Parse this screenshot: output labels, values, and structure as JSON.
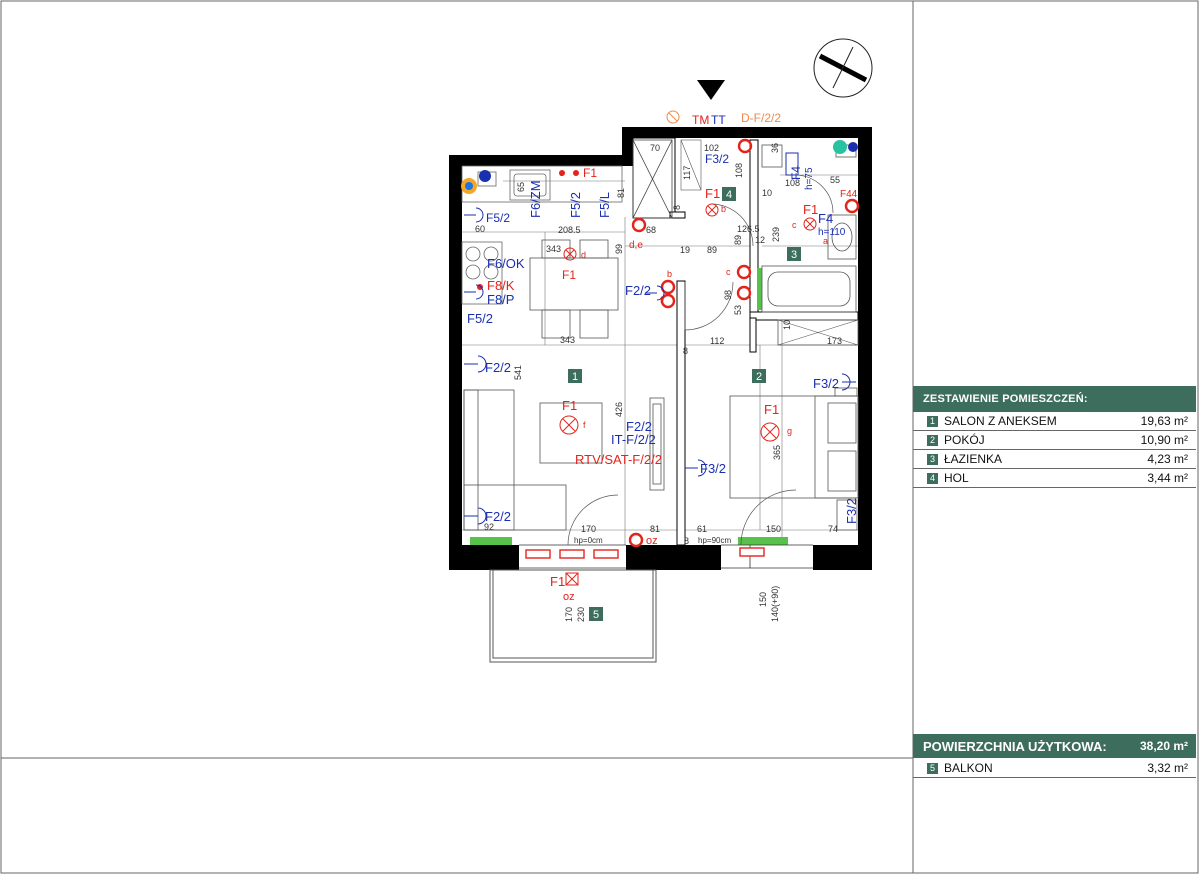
{
  "legend": {
    "title": "ZESTAWIENIE POMIESZCZEŃ:",
    "rooms": [
      {
        "num": "1",
        "name": "SALON Z ANEKSEM",
        "area": "19,63 m²"
      },
      {
        "num": "2",
        "name": "POKÓJ",
        "area": "10,90 m²"
      },
      {
        "num": "3",
        "name": "ŁAZIENKA",
        "area": "4,23 m²"
      },
      {
        "num": "4",
        "name": "HOL",
        "area": "3,44 m²"
      }
    ],
    "total_label": "POWIERZCHNIA UŻYTKOWA:",
    "total_value": "38,20 m²",
    "extra": {
      "num": "5",
      "name": "BALKON",
      "area": "3,32 m²"
    }
  },
  "plan": {
    "room_badges": [
      "1",
      "2",
      "3",
      "4",
      "5"
    ],
    "labels": {
      "tm": "TM",
      "tt": "TT",
      "dfd": "D-F/2/2",
      "f32_top": "F3/2",
      "f1_hol": "F1",
      "f4_top": "F4",
      "h75": "h=75",
      "f1_bath": "F1",
      "f4_bath": "F4",
      "h110": "h=110",
      "f44": "F44",
      "f1_kitchen": "F1",
      "f6zm": "F6/ZM",
      "f52_k": "F5/2",
      "f5l": "F5/L",
      "f52_left": "F5/2",
      "f6ok": "F6/OK",
      "f8k": "F8/K",
      "f8p": "F8/P",
      "f52_left2": "F5/2",
      "f1_table": "F1",
      "f22_hall": "F2/2",
      "de": "d,e",
      "f22_l1": "F2/2",
      "f1_salon": "F1",
      "f22_tv": "F2/2",
      "itf": "IT-F/2/2",
      "rtv": "RTV/SAT-F/2/2",
      "f22_l2": "F2/2",
      "f32_mid": "F3/2",
      "f1_pokoj": "F1",
      "f32_right": "F3/2",
      "f32_right2": "F3/2",
      "f1_balcony": "F1",
      "oz": "oz",
      "oz2": "oz",
      "hp0": "hp=0cm",
      "hp90": "hp=90cm",
      "d_b": "b",
      "d_d": "d",
      "d_f": "f",
      "d_g": "g",
      "d_c": "c",
      "d_a": "a",
      "d_e": "e",
      "d_c2": "c",
      "d_f2": "f",
      "d_b2": "b"
    },
    "dims": {
      "d70": "70",
      "d102": "102",
      "d117": "117",
      "d81": "81",
      "d8": "8",
      "d36": "36",
      "d108a": "108",
      "d108b": "108",
      "d10": "10",
      "d55": "55",
      "d126": "126.5",
      "d239": "239",
      "d89a": "89",
      "d12": "12",
      "d19": "19",
      "d89b": "89",
      "d99": "99",
      "d68": "68",
      "d60": "60",
      "d2085": "208.5",
      "d343a": "343",
      "d343b": "343",
      "d65": "65",
      "d541": "541",
      "d426": "426",
      "d112": "112",
      "d173": "173",
      "d8b": "8",
      "d53": "53",
      "d98": "98",
      "d10b": "10",
      "d365": "365",
      "d92": "92",
      "d170": "170",
      "d81b": "81",
      "d61": "61",
      "d150": "150",
      "d74": "74",
      "d8c": "8",
      "d170b": "170",
      "d230": "230",
      "d150b": "150",
      "d140": "140(+90)"
    }
  }
}
